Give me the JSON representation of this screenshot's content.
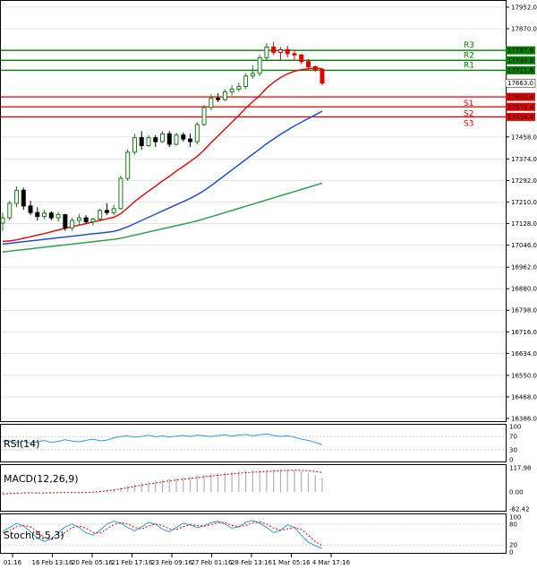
{
  "chart_data": {
    "type": "candlestick",
    "price_axis": {
      "ticks": [
        "17952.0",
        "17870.0",
        "17458.0",
        "17374.0",
        "17292.0",
        "17210.0",
        "17128.0",
        "17046.0",
        "16962.0",
        "16880.0",
        "16798.0",
        "16716.0",
        "16634.0",
        "16550.0",
        "16468.0",
        "16386.0"
      ],
      "ylim": [
        16386,
        17952
      ]
    },
    "time_axis": {
      "labels": [
        "01:16",
        "16 Feb 13:16",
        "20 Feb 05:16",
        "21 Feb 17:16",
        "23 Feb 09:16",
        "27 Feb 01:16",
        "28 Feb 13:16",
        "1 Mar 05:16",
        "4 Mar 17:16"
      ]
    },
    "levels": [
      {
        "name": "R3",
        "value": 17787.6,
        "label": "17787.6",
        "color": "#008000"
      },
      {
        "name": "R2",
        "value": 17749.6,
        "label": "17749.6",
        "color": "#008000"
      },
      {
        "name": "R1",
        "value": 17711.6,
        "label": "17711.6",
        "color": "#008000"
      },
      {
        "name": "S1",
        "value": 17610.4,
        "label": "17610.4",
        "color": "#e00000"
      },
      {
        "name": "S2",
        "value": 17572.4,
        "label": "17572.4",
        "color": "#e00000"
      },
      {
        "name": "S3",
        "value": 17534.4,
        "label": "17534.4",
        "color": "#e00000"
      }
    ],
    "current_price": {
      "value": 17663.0,
      "label": "17663.0"
    },
    "candles": [
      {
        "o": 17130,
        "h": 17170,
        "l": 17100,
        "c": 17150
      },
      {
        "o": 17150,
        "h": 17215,
        "l": 17140,
        "c": 17205
      },
      {
        "o": 17205,
        "h": 17270,
        "l": 17190,
        "c": 17255
      },
      {
        "o": 17255,
        "h": 17265,
        "l": 17180,
        "c": 17195
      },
      {
        "o": 17195,
        "h": 17215,
        "l": 17160,
        "c": 17170
      },
      {
        "o": 17170,
        "h": 17190,
        "l": 17140,
        "c": 17155
      },
      {
        "o": 17155,
        "h": 17180,
        "l": 17145,
        "c": 17168
      },
      {
        "o": 17168,
        "h": 17175,
        "l": 17140,
        "c": 17150
      },
      {
        "o": 17150,
        "h": 17172,
        "l": 17135,
        "c": 17162
      },
      {
        "o": 17162,
        "h": 17165,
        "l": 17100,
        "c": 17112
      },
      {
        "o": 17112,
        "h": 17150,
        "l": 17100,
        "c": 17140
      },
      {
        "o": 17140,
        "h": 17165,
        "l": 17120,
        "c": 17150
      },
      {
        "o": 17150,
        "h": 17160,
        "l": 17125,
        "c": 17135
      },
      {
        "o": 17135,
        "h": 17150,
        "l": 17120,
        "c": 17145
      },
      {
        "o": 17145,
        "h": 17185,
        "l": 17140,
        "c": 17178
      },
      {
        "o": 17178,
        "h": 17205,
        "l": 17160,
        "c": 17170
      },
      {
        "o": 17170,
        "h": 17200,
        "l": 17160,
        "c": 17185
      },
      {
        "o": 17185,
        "h": 17310,
        "l": 17180,
        "c": 17300
      },
      {
        "o": 17300,
        "h": 17410,
        "l": 17290,
        "c": 17400
      },
      {
        "o": 17400,
        "h": 17470,
        "l": 17390,
        "c": 17455
      },
      {
        "o": 17455,
        "h": 17480,
        "l": 17410,
        "c": 17425
      },
      {
        "o": 17425,
        "h": 17465,
        "l": 17420,
        "c": 17455
      },
      {
        "o": 17455,
        "h": 17465,
        "l": 17420,
        "c": 17440
      },
      {
        "o": 17440,
        "h": 17480,
        "l": 17435,
        "c": 17470
      },
      {
        "o": 17470,
        "h": 17480,
        "l": 17420,
        "c": 17430
      },
      {
        "o": 17430,
        "h": 17475,
        "l": 17425,
        "c": 17465
      },
      {
        "o": 17465,
        "h": 17475,
        "l": 17440,
        "c": 17450
      },
      {
        "o": 17450,
        "h": 17470,
        "l": 17420,
        "c": 17440
      },
      {
        "o": 17440,
        "h": 17515,
        "l": 17430,
        "c": 17505
      },
      {
        "o": 17505,
        "h": 17580,
        "l": 17500,
        "c": 17570
      },
      {
        "o": 17570,
        "h": 17620,
        "l": 17560,
        "c": 17605
      },
      {
        "o": 17605,
        "h": 17625,
        "l": 17590,
        "c": 17600
      },
      {
        "o": 17600,
        "h": 17640,
        "l": 17595,
        "c": 17630
      },
      {
        "o": 17630,
        "h": 17655,
        "l": 17615,
        "c": 17640
      },
      {
        "o": 17640,
        "h": 17665,
        "l": 17630,
        "c": 17650
      },
      {
        "o": 17650,
        "h": 17700,
        "l": 17640,
        "c": 17690
      },
      {
        "o": 17690,
        "h": 17730,
        "l": 17680,
        "c": 17700
      },
      {
        "o": 17700,
        "h": 17770,
        "l": 17690,
        "c": 17760
      },
      {
        "o": 17760,
        "h": 17815,
        "l": 17750,
        "c": 17800
      },
      {
        "o": 17800,
        "h": 17820,
        "l": 17770,
        "c": 17780
      },
      {
        "o": 17780,
        "h": 17800,
        "l": 17750,
        "c": 17790
      },
      {
        "o": 17790,
        "h": 17805,
        "l": 17760,
        "c": 17775
      },
      {
        "o": 17775,
        "h": 17790,
        "l": 17750,
        "c": 17770
      },
      {
        "o": 17770,
        "h": 17775,
        "l": 17735,
        "c": 17745
      },
      {
        "o": 17745,
        "h": 17755,
        "l": 17715,
        "c": 17725
      },
      {
        "o": 17725,
        "h": 17730,
        "l": 17705,
        "c": 17715
      },
      {
        "o": 17715,
        "h": 17720,
        "l": 17655,
        "c": 17663
      }
    ],
    "moving_averages": [
      {
        "color": "#e01010",
        "values": [
          17060,
          17062,
          17066,
          17072,
          17078,
          17084,
          17090,
          17097,
          17104,
          17110,
          17116,
          17122,
          17128,
          17134,
          17140,
          17146,
          17152,
          17166,
          17188,
          17212,
          17232,
          17252,
          17270,
          17290,
          17308,
          17328,
          17346,
          17364,
          17384,
          17408,
          17436,
          17462,
          17488,
          17514,
          17540,
          17568,
          17592,
          17616,
          17644,
          17666,
          17684,
          17698,
          17708,
          17714,
          17718,
          17720,
          17718
        ]
      },
      {
        "color": "#2050d0",
        "values": [
          17050,
          17053,
          17056,
          17059,
          17062,
          17065,
          17068,
          17071,
          17074,
          17077,
          17080,
          17083,
          17086,
          17089,
          17092,
          17095,
          17098,
          17106,
          17116,
          17128,
          17140,
          17152,
          17164,
          17176,
          17188,
          17200,
          17212,
          17224,
          17238,
          17254,
          17272,
          17292,
          17312,
          17332,
          17352,
          17372,
          17392,
          17412,
          17432,
          17450,
          17468,
          17484,
          17500,
          17514,
          17528,
          17542,
          17556
        ]
      },
      {
        "color": "#30a050",
        "values": [
          17020,
          17023,
          17026,
          17029,
          17032,
          17035,
          17038,
          17041,
          17044,
          17047,
          17050,
          17053,
          17056,
          17059,
          17062,
          17065,
          17068,
          17072,
          17078,
          17084,
          17090,
          17096,
          17102,
          17108,
          17114,
          17120,
          17126,
          17132,
          17138,
          17146,
          17154,
          17162,
          17170,
          17178,
          17186,
          17194,
          17202,
          17210,
          17218,
          17226,
          17234,
          17242,
          17250,
          17258,
          17266,
          17274,
          17282
        ]
      }
    ],
    "indicators": {
      "rsi": {
        "title": "RSI(14)",
        "ticks": [
          "100",
          "70",
          "30",
          "0"
        ],
        "values": [
          55,
          57,
          52,
          56,
          50,
          54,
          58,
          52,
          55,
          60,
          56,
          54,
          58,
          62,
          57,
          59,
          66,
          70,
          72,
          68,
          70,
          74,
          69,
          72,
          68,
          71,
          73,
          70,
          74,
          72,
          70,
          73,
          75,
          71,
          74,
          76,
          72,
          75,
          78,
          73,
          70,
          72,
          68,
          62,
          58,
          52,
          45
        ]
      },
      "macd": {
        "title": "MACD(12,26,9)",
        "ticks": [
          "117.98",
          "0.00",
          "-82.42"
        ],
        "histogram": [
          -8,
          -6,
          -4,
          -3,
          -5,
          -6,
          -4,
          -3,
          -2,
          -3,
          -4,
          -2,
          -1,
          0,
          5,
          10,
          15,
          22,
          30,
          38,
          44,
          50,
          55,
          60,
          64,
          68,
          72,
          76,
          80,
          84,
          88,
          92,
          95,
          98,
          100,
          102,
          104,
          106,
          108,
          110,
          111,
          110,
          106,
          100,
          92,
          82,
          70
        ],
        "signal": [
          -10,
          -8,
          -6,
          -5,
          -4,
          -5,
          -5,
          -4,
          -3,
          -3,
          -3,
          -3,
          -2,
          -1,
          2,
          6,
          10,
          15,
          21,
          27,
          33,
          39,
          44,
          49,
          54,
          58,
          62,
          66,
          70,
          74,
          78,
          82,
          85,
          88,
          91,
          94,
          96,
          98,
          100,
          102,
          104,
          105,
          106,
          105,
          103,
          100,
          95
        ]
      },
      "stoch": {
        "title": "Stoch(5,5,3)",
        "ticks": [
          "100",
          "80",
          "20",
          "0"
        ],
        "k": [
          60,
          70,
          82,
          75,
          58,
          40,
          30,
          38,
          55,
          72,
          80,
          70,
          55,
          48,
          62,
          80,
          88,
          82,
          70,
          60,
          72,
          85,
          80,
          65,
          58,
          70,
          82,
          78,
          70,
          75,
          84,
          88,
          80,
          68,
          72,
          85,
          90,
          82,
          70,
          55,
          62,
          78,
          70,
          48,
          28,
          18,
          10
        ],
        "d": [
          55,
          62,
          72,
          76,
          72,
          58,
          42,
          36,
          42,
          56,
          70,
          74,
          68,
          56,
          54,
          66,
          78,
          84,
          80,
          70,
          66,
          74,
          80,
          76,
          66,
          64,
          72,
          78,
          76,
          74,
          78,
          84,
          84,
          76,
          72,
          76,
          84,
          86,
          80,
          68,
          62,
          66,
          70,
          64,
          48,
          30,
          18
        ]
      }
    }
  }
}
